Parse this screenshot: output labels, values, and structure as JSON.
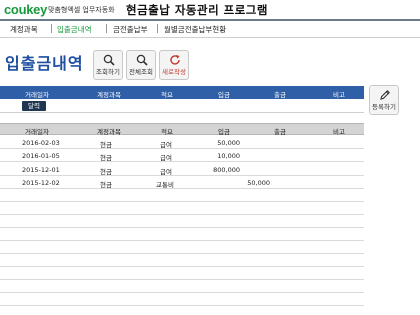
{
  "header": {
    "logo": "coukey",
    "logo_sub": "맞춤형엑셀 업무자동화",
    "title": "현금출납 자동관리 프로그램"
  },
  "menu": {
    "items": [
      {
        "label": "계정과목",
        "active": false
      },
      {
        "label": "입출금내역",
        "active": true
      },
      {
        "label": "금전출납부",
        "active": false
      },
      {
        "label": "월별금전출납부현황",
        "active": false
      }
    ]
  },
  "page": {
    "title": "입출금내역"
  },
  "toolbar": {
    "search_label": "조회하기",
    "view_all_label": "전체조회",
    "new_label": "새로작성",
    "register_label": "등록하기"
  },
  "input_table": {
    "columns": [
      "거래일자",
      "계정과목",
      "적요",
      "입금",
      "출금",
      "비고"
    ],
    "calendar_label": "달력"
  },
  "list": {
    "columns": [
      "거래일자",
      "계정과목",
      "적요",
      "입금",
      "출금",
      "비고"
    ],
    "rows": [
      {
        "date": "2016-02-03",
        "account": "현금",
        "memo": "급여",
        "deposit": "50,000",
        "withdrawal": "",
        "note": ""
      },
      {
        "date": "2016-01-05",
        "account": "현금",
        "memo": "급여",
        "deposit": "10,000",
        "withdrawal": "",
        "note": ""
      },
      {
        "date": "2015-12-01",
        "account": "현금",
        "memo": "급여",
        "deposit": "800,000",
        "withdrawal": "",
        "note": ""
      },
      {
        "date": "2015-12-02",
        "account": "현금",
        "memo": "교통비",
        "deposit": "",
        "withdrawal": "50,000",
        "note": ""
      }
    ]
  },
  "colors": {
    "brand_green": "#1a9a3c",
    "title_blue": "#1e4fa0",
    "header_blue": "#2f5fa6",
    "new_red": "#c0392b"
  }
}
